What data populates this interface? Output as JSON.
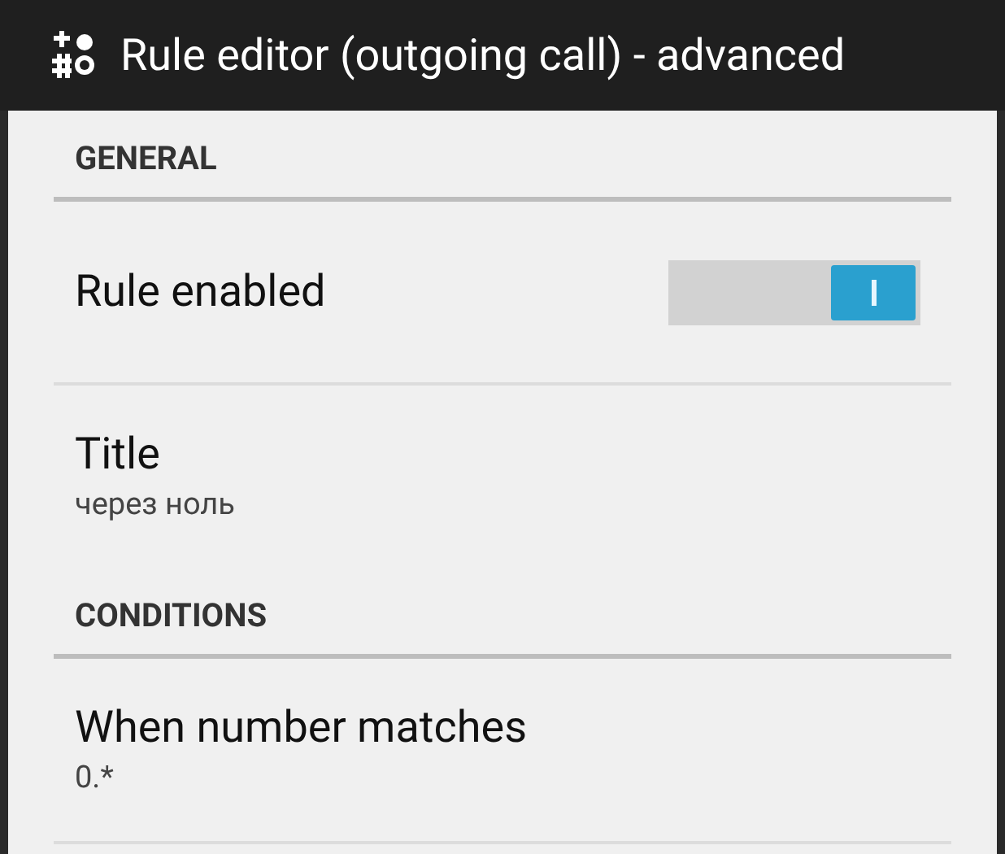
{
  "window": {
    "title": "Rule editor (outgoing call) - advanced"
  },
  "items": [
    {
      "kind": "header",
      "label": "GENERAL"
    },
    {
      "kind": "switch",
      "label": "Rule enabled",
      "on": true
    },
    {
      "kind": "text",
      "label": "Title",
      "value": "через ноль"
    },
    {
      "kind": "header",
      "label": "CONDITIONS"
    },
    {
      "kind": "text",
      "label": "When number matches",
      "value": "0.*"
    }
  ]
}
